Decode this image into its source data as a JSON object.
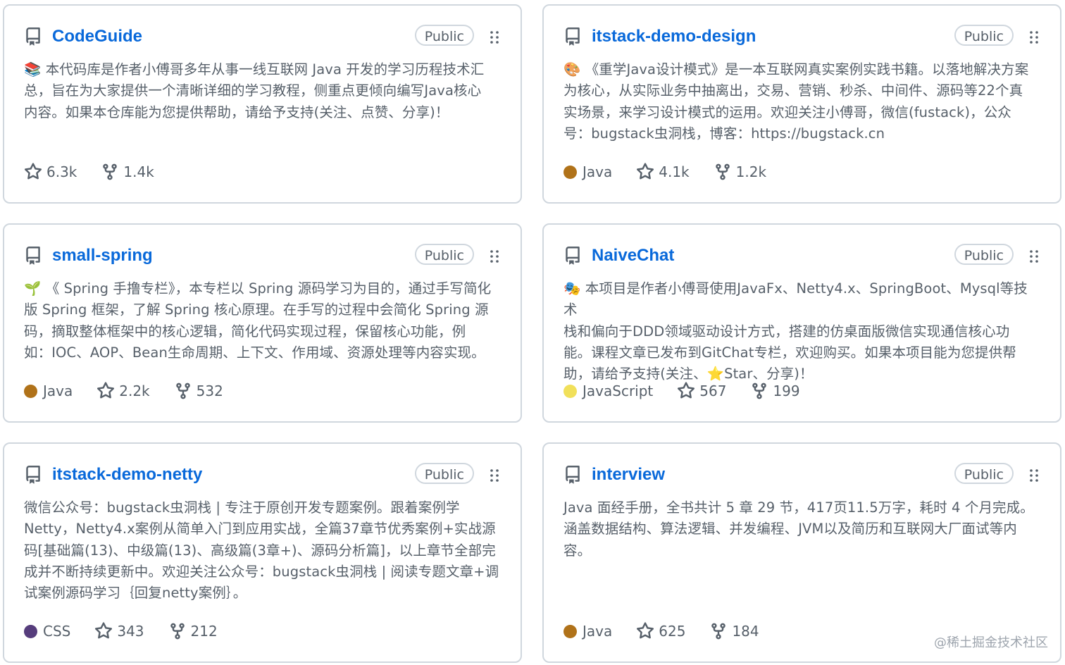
{
  "badge_label": "Public",
  "repos": [
    {
      "name": "CodeGuide",
      "emoji": "📚",
      "description": "本代码库是作者小傅哥多年从事一线互联网 Java 开发的学习历程技术汇\n总，旨在为大家提供一个清晰详细的学习教程，侧重点更倾向编写Java核心\n内容。如果本仓库能为您提供帮助，请给予支持(关注、点赞、分享)！",
      "language": "",
      "language_color": "",
      "stars": "6.3k",
      "forks": "1.4k"
    },
    {
      "name": "itstack-demo-design",
      "emoji": "🎨",
      "description": "《重学Java设计模式》是一本互联网真实案例实践书籍。以落地解决方案\n为核心，从实际业务中抽离出，交易、营销、秒杀、中间件、源码等22个真\n实场景，来学习设计模式的运用。欢迎关注小傅哥，微信(fustack)，公众\n号：bugstack虫洞栈，博客：https://bugstack.cn",
      "language": "Java",
      "language_color": "#b07219",
      "stars": "4.1k",
      "forks": "1.2k"
    },
    {
      "name": "small-spring",
      "emoji": "🌱",
      "description": "《 Spring 手撸专栏》，本专栏以 Spring 源码学习为目的，通过手写简化\n版 Spring 框架，了解 Spring 核心原理。在手写的过程中会简化 Spring 源\n码，摘取整体框架中的核心逻辑，简化代码实现过程，保留核心功能，例\n如：IOC、AOP、Bean生命周期、上下文、作用域、资源处理等内容实现。",
      "language": "Java",
      "language_color": "#b07219",
      "stars": "2.2k",
      "forks": "532"
    },
    {
      "name": "NaiveChat",
      "emoji": "🎭",
      "description": "本项目是作者小傅哥使用JavaFx、Netty4.x、SpringBoot、Mysql等技术\n栈和偏向于DDD领域驱动设计方式，搭建的仿桌面版微信实现通信核心功\n能。课程文章已发布到GitChat专栏，欢迎购买。如果本项目能为您提供帮\n助，请给予支持(关注、⭐Star、分享)！",
      "language": "JavaScript",
      "language_color": "#f1e05a",
      "stars": "567",
      "forks": "199"
    },
    {
      "name": "itstack-demo-netty",
      "emoji": "",
      "description": "微信公众号：bugstack虫洞栈 | 专注于原创开发专题案例。跟着案例学\nNetty，Netty4.x案例从简单入门到应用实战，全篇37章节优秀案例+实战源\n码[基础篇(13)、中级篇(13)、高级篇(3章+)、源码分析篇]，以上章节全部完\n成并不断持续更新中。欢迎关注公众号：bugstack虫洞栈 | 阅读专题文章+调\n试案例源码学习｛回复netty案例｝。",
      "language": "CSS",
      "language_color": "#563d7c",
      "stars": "343",
      "forks": "212"
    },
    {
      "name": "interview",
      "emoji": "",
      "description": "Java 面经手册，全书共计 5 章 29 节，417页11.5万字，耗时 4 个月完成。\n涵盖数据结构、算法逻辑、并发编程、JVM以及简历和互联网大厂面试等内\n容。",
      "language": "Java",
      "language_color": "#b07219",
      "stars": "625",
      "forks": "184"
    }
  ],
  "watermark": "@稀土掘金技术社区"
}
